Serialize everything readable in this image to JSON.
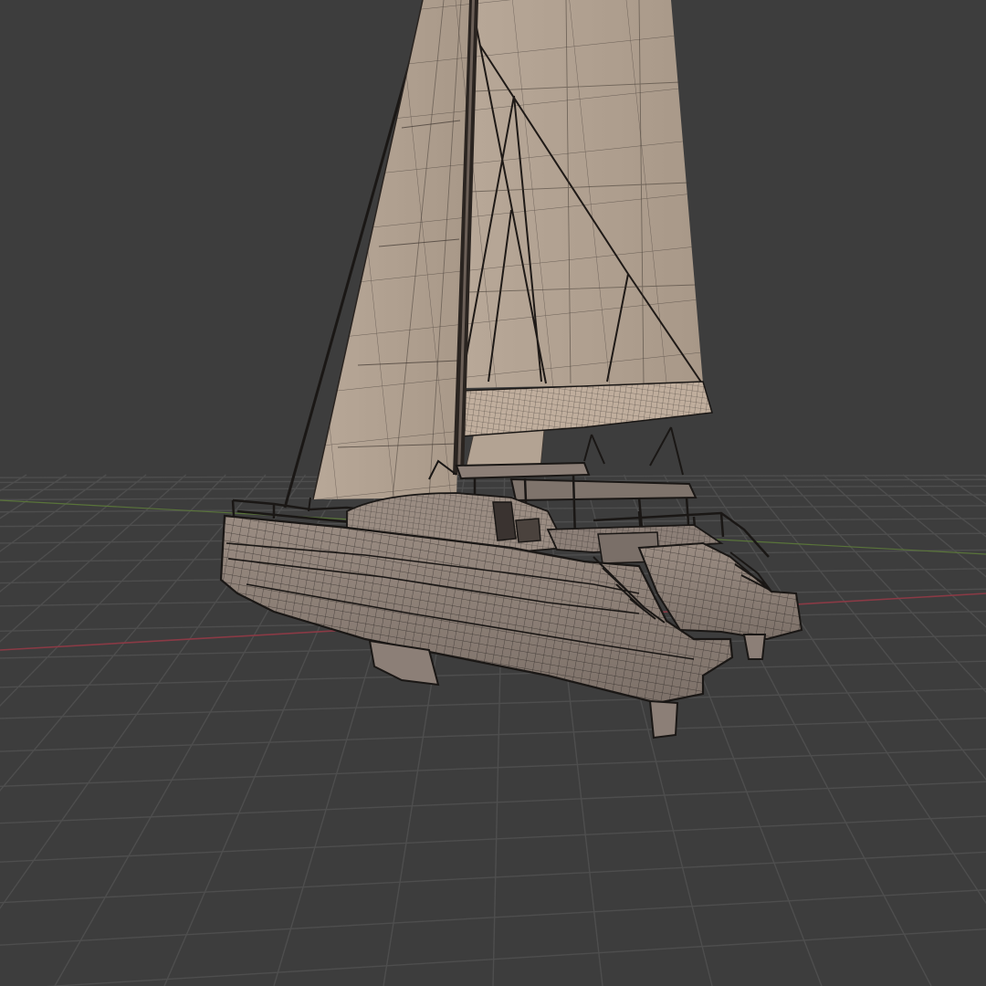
{
  "viewport": {
    "background": "#3d3d3d",
    "grid_color": "#4e4e4e",
    "x_axis_color": "#8a3a45",
    "y_axis_color": "#5d7a3a"
  },
  "model": {
    "subject": "catamaran",
    "display_mode": "solid-with-wireframe",
    "surface_color": "#8c7f77",
    "surface_light_color": "#a49689",
    "sail_color": "#b3a393",
    "wire_color": "#1a1715"
  }
}
